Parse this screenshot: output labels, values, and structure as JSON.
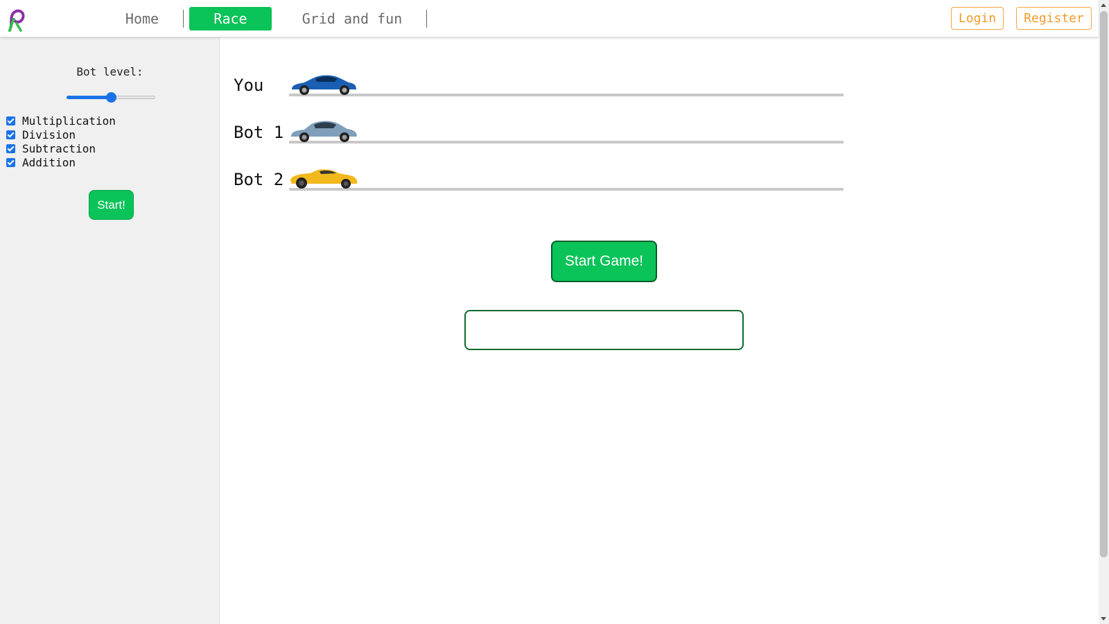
{
  "nav": {
    "home": "Home",
    "race": "Race",
    "grid": "Grid and fun",
    "login": "Login",
    "register": "Register"
  },
  "sidebar": {
    "bot_level_label": "Bot level:",
    "bot_level_fraction": 0.5,
    "options": [
      {
        "label": "Multiplication",
        "checked": true
      },
      {
        "label": "Division",
        "checked": true
      },
      {
        "label": "Subtraction",
        "checked": true
      },
      {
        "label": "Addition",
        "checked": true
      }
    ],
    "start_label": "Start!"
  },
  "race": {
    "racers": [
      {
        "label": "You",
        "car_color": "#1a5fb4"
      },
      {
        "label": "Bot 1",
        "car_color": "#7f9fba"
      },
      {
        "label": "Bot 2",
        "car_color": "#f2b81c"
      }
    ],
    "start_game_label": "Start Game!",
    "answer_value": ""
  },
  "colors": {
    "accent_green": "#0ac359",
    "auth_orange": "#f39a28",
    "slider_blue": "#1a73e8"
  }
}
